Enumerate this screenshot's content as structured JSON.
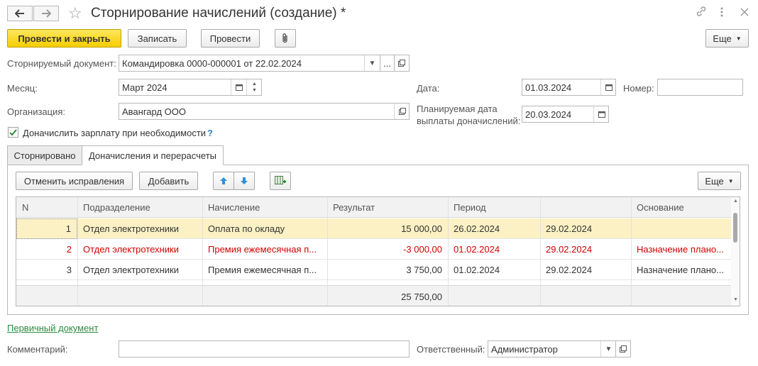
{
  "window": {
    "title": "Сторнирование начислений (создание) *",
    "back_icon": "arrow-left-icon",
    "forward_icon": "arrow-right-icon",
    "favorite_icon": "star-icon"
  },
  "toolbar": {
    "post_and_close": "Провести и закрыть",
    "save": "Записать",
    "post": "Провести",
    "more": "Еще"
  },
  "form": {
    "reversed_doc_label": "Сторнируемый документ:",
    "reversed_doc_value": "Командировка 0000-000001 от 22.02.2024",
    "ellipsis": "...",
    "month_label": "Месяц:",
    "month_value": "Март 2024",
    "date_label": "Дата:",
    "date_value": "01.03.2024",
    "number_label": "Номер:",
    "number_value": "",
    "org_label": "Организация:",
    "org_value": "Авангард ООО",
    "planned_date_label_1": "Планируемая дата",
    "planned_date_label_2": "выплаты доначислений:",
    "planned_date_value": "20.03.2024",
    "checkbox_label": "Доначислить зарплату при необходимости",
    "help": "?"
  },
  "tabs": [
    {
      "label": "Сторнировано"
    },
    {
      "label": "Доначисления и перерасчеты"
    }
  ],
  "table_toolbar": {
    "cancel_corrections": "Отменить исправления",
    "add": "Добавить",
    "more": "Еще"
  },
  "table": {
    "headers": [
      "N",
      "Подразделение",
      "Начисление",
      "Результат",
      "Период",
      "",
      "Основание"
    ],
    "rows": [
      [
        "1",
        "Отдел электротехники",
        "Оплата по окладу",
        "15 000,00",
        "26.02.2024",
        "29.02.2024",
        ""
      ],
      [
        "2",
        "Отдел электротехники",
        "Премия ежемесячная п...",
        "-3 000,00",
        "01.02.2024",
        "29.02.2024",
        "Назначение плано..."
      ],
      [
        "3",
        "Отдел электротехники",
        "Премия ежемесячная п...",
        "3 750,00",
        "01.02.2024",
        "29.02.2024",
        "Назначение плано..."
      ]
    ],
    "total": "25 750,00"
  },
  "bottom": {
    "primary_doc_link": "Первичный документ",
    "comment_label": "Комментарий:",
    "comment_value": "",
    "responsible_label": "Ответственный:",
    "responsible_value": "Администратор"
  },
  "colors": {
    "primary_button": "#f5cd00",
    "negative_row": "#d10000",
    "selected_row": "#fbf1c4",
    "link": "#2b8a3e"
  }
}
